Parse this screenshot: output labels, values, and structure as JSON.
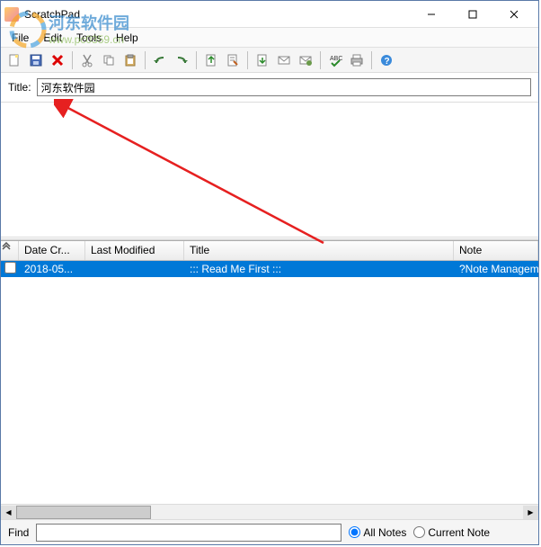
{
  "window": {
    "title": "ScratchPad"
  },
  "menu": {
    "file": "File",
    "edit": "Edit",
    "tools": "Tools",
    "help": "Help"
  },
  "titleField": {
    "label": "Title:",
    "value": "河东软件园"
  },
  "columns": {
    "expand": "☆",
    "date": "Date Cr...",
    "modified": "Last Modified",
    "title": "Title",
    "note": "Note"
  },
  "rows": [
    {
      "date": "2018-05...",
      "modified": "",
      "title": "::: Read Me First :::",
      "note": "?Note Management.?F"
    }
  ],
  "find": {
    "label": "Find",
    "value": "",
    "all": "All Notes",
    "current": "Current Note"
  },
  "watermark": {
    "text1": "河东软件园",
    "text2": "www.pc0359.cn"
  },
  "icons": {
    "new": "new-doc",
    "save": "save",
    "delete": "delete",
    "cut": "cut",
    "copy": "copy",
    "paste": "paste",
    "undo": "undo",
    "redo": "redo",
    "insert": "insert",
    "date": "date",
    "attach": "attach",
    "mail": "mail",
    "export": "export",
    "spell": "spell",
    "print": "print",
    "helpb": "help"
  }
}
